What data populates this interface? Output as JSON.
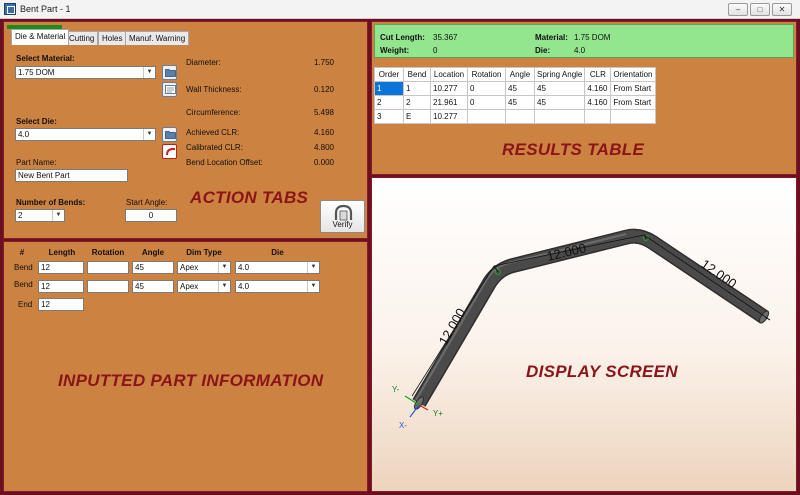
{
  "window": {
    "title": "Bent Part - 1",
    "buttons": [
      "–",
      "□",
      "✕"
    ]
  },
  "icons": {
    "app": "app-icon",
    "browse": "folder-icon",
    "material_info": "material-list-icon",
    "die_info": "die-curve-icon",
    "verify": "bender-icon"
  },
  "colors": {
    "panel": "#cc8240",
    "frame": "#6b1020",
    "watermark": "#8b1418",
    "results_summary": "#93e58e",
    "selected_row": "#0a74d8",
    "tube": "#4a4a4a"
  },
  "tabs": [
    {
      "label": "Die & Material",
      "active": true
    },
    {
      "label": "Cutting",
      "active": false
    },
    {
      "label": "Holes",
      "active": false
    },
    {
      "label": "Manuf. Warning",
      "active": false
    }
  ],
  "action": {
    "select_material_label": "Select Material:",
    "material_value": "1.75 DOM",
    "select_die_label": "Select Die:",
    "die_value": "4.0",
    "part_name_label": "Part Name:",
    "part_name_value": "New Bent Part",
    "num_bends_label": "Number of Bends:",
    "num_bends_value": "2",
    "start_angle_label": "Start Angle:",
    "start_angle_value": "0",
    "verify_label": "Verify",
    "props": [
      {
        "label": "Diameter:",
        "value": "1.750"
      },
      {
        "label": "Wall Thickness:",
        "value": "0.120"
      },
      {
        "label": "Circumference:",
        "value": "5.498"
      },
      {
        "label": "Achieved CLR:",
        "value": "4.160"
      },
      {
        "label": "Calibrated CLR:",
        "value": "4.800"
      },
      {
        "label": "Bend Location Offset:",
        "value": "0.000"
      }
    ]
  },
  "annotations": {
    "action": "ACTION TABS",
    "input": "INPUTTED PART INFORMATION",
    "results": "RESULTS TABLE",
    "display": "DISPLAY SCREEN"
  },
  "inputs": {
    "headers": [
      "#",
      "Length",
      "Rotation",
      "Angle",
      "Dim Type",
      "Die"
    ],
    "rows": [
      {
        "label": "Bend",
        "length": "12",
        "rotation": "",
        "angle": "45",
        "dim_type": "Apex",
        "die": "4.0"
      },
      {
        "label": "Bend",
        "length": "12",
        "rotation": "",
        "angle": "45",
        "dim_type": "Apex",
        "die": "4.0"
      }
    ],
    "end": {
      "label": "End",
      "length": "12"
    }
  },
  "results": {
    "summary": {
      "cut_length_label": "Cut Length:",
      "cut_length": "35.367",
      "weight_label": "Weight:",
      "weight": "0",
      "material_label": "Material:",
      "material": "1.75 DOM",
      "die_label": "Die:",
      "die": "4.0"
    },
    "columns": [
      "Order",
      "Bend",
      "Location",
      "Rotation",
      "Angle",
      "Spring Angle",
      "CLR",
      "Orientation"
    ],
    "rows": [
      [
        "1",
        "1",
        "10.277",
        "0",
        "45",
        "45",
        "4.160",
        "From Start"
      ],
      [
        "2",
        "2",
        "21.961",
        "0",
        "45",
        "45",
        "4.160",
        "From Start"
      ],
      [
        "3",
        "E",
        "10.277",
        "",
        "",
        "",
        "",
        ""
      ]
    ]
  },
  "display": {
    "dim_labels": [
      "12.000",
      "12.000",
      "12.000"
    ],
    "axes": {
      "y_neg": "Y-",
      "y_pos": "Y+",
      "x_neg": "X-"
    }
  }
}
